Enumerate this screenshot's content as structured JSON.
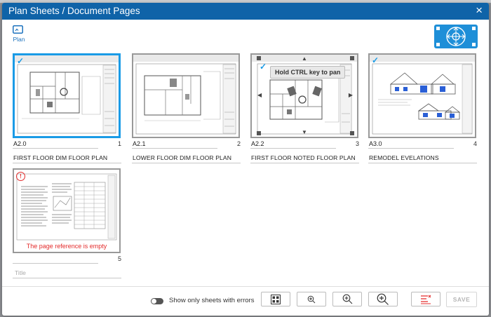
{
  "dialog": {
    "title": "Plan Sheets / Document Pages",
    "close_glyph": "×"
  },
  "tabs": [
    {
      "label": "Plan",
      "icon": "plan-icon"
    }
  ],
  "nav_widget": {
    "icon": "pan-navigation-icon"
  },
  "sheets": [
    {
      "ref": "A2.0",
      "number": "1",
      "name": "FIRST FLOOR DIM FLOOR PLAN",
      "selected": true,
      "checked": true
    },
    {
      "ref": "A2.1",
      "number": "2",
      "name": "LOWER FLOOR DIM FLOOR PLAN",
      "selected": false,
      "checked": false
    },
    {
      "ref": "A2.2",
      "number": "3",
      "name": "FIRST FLOOR NOTED FLOOR PLAN",
      "selected": false,
      "checked": true,
      "tooltip": "Hold CTRL key to pan"
    },
    {
      "ref": "A3.0",
      "number": "4",
      "name": "REMODEL EVELATIONS",
      "selected": false,
      "checked": true
    },
    {
      "ref": "",
      "number": "5",
      "name": "",
      "title_placeholder": "Title",
      "error": "The page reference is empty",
      "error_icon": "!"
    }
  ],
  "footer": {
    "toggle_label": "Show only sheets with errors",
    "toggle_on": false,
    "buttons": [
      {
        "icon": "grid-view-icon"
      },
      {
        "icon": "zoom-small-icon"
      },
      {
        "icon": "zoom-medium-icon"
      },
      {
        "icon": "zoom-large-icon"
      },
      {
        "icon": "error-filter-icon"
      }
    ],
    "save_label": "SAVE"
  },
  "colors": {
    "title_bar": "#0f63a8",
    "accent": "#1a9be6",
    "error": "#e32b2b"
  }
}
